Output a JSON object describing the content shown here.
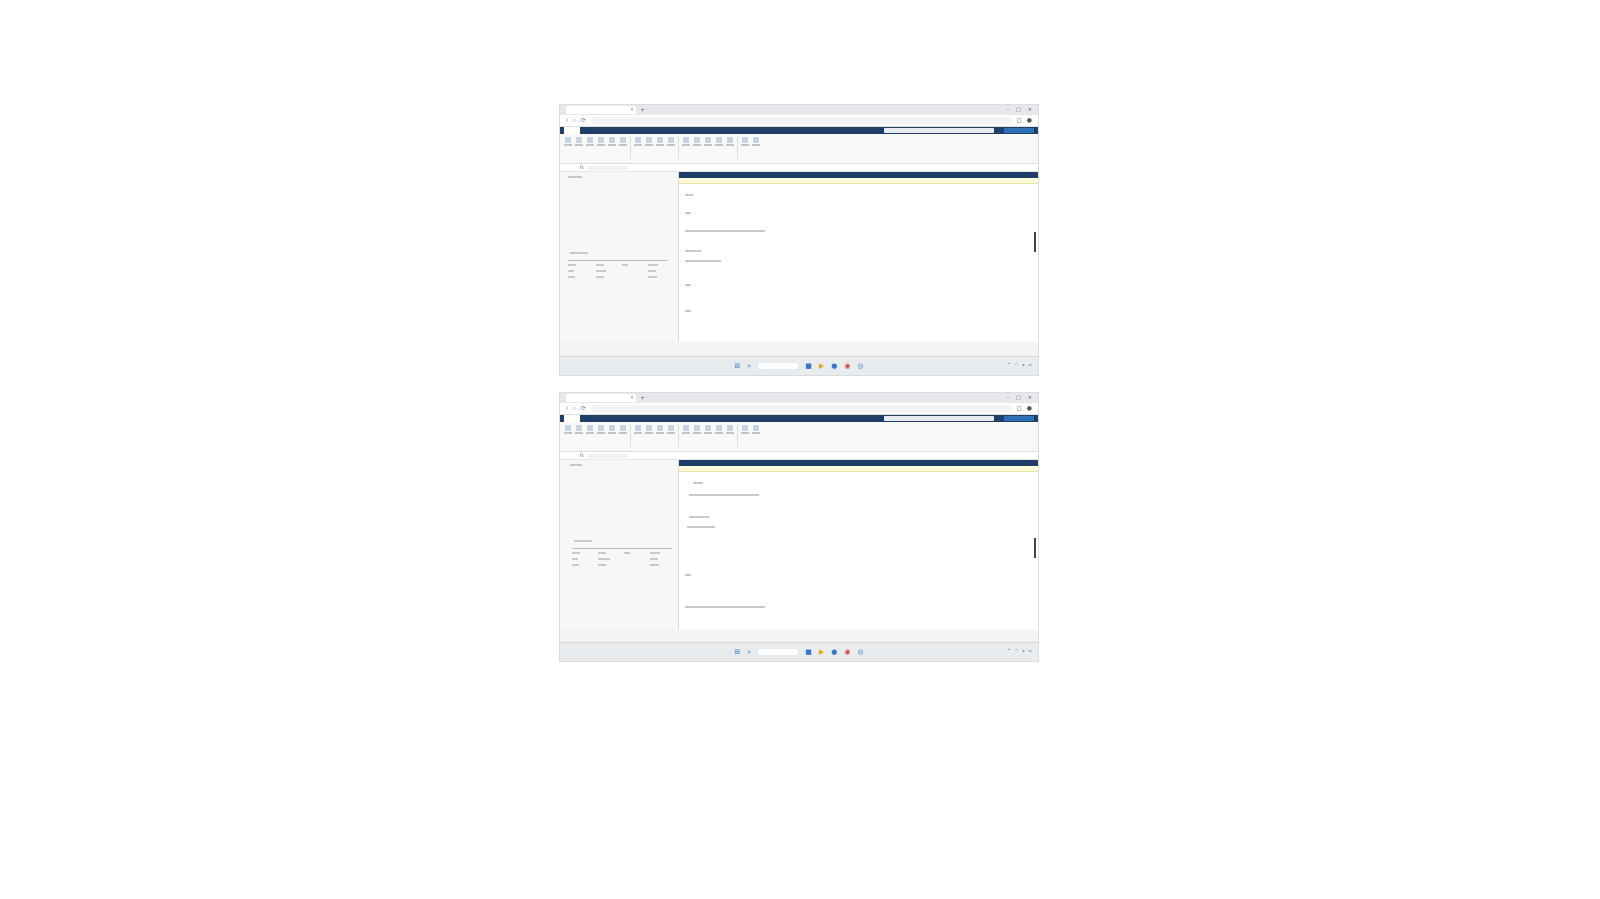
{
  "screenshots": [
    {
      "tab": {
        "title": "",
        "close": "×"
      },
      "new_tab": "+",
      "window_controls": [
        "–",
        "□",
        "×"
      ],
      "address": {
        "url": ""
      },
      "nav_icons": [
        "‹",
        "›",
        "⟳"
      ],
      "app_tabs": [
        "",
        "",
        ""
      ],
      "formula_label": "fx",
      "taskbar_icons": [
        "⊞",
        "⌕",
        "■",
        "▶",
        "●",
        "◉",
        "◎"
      ]
    },
    {
      "tab": {
        "title": "",
        "close": "×"
      },
      "new_tab": "+",
      "window_controls": [
        "–",
        "□",
        "×"
      ],
      "address": {
        "url": ""
      },
      "nav_icons": [
        "‹",
        "›",
        "⟳"
      ],
      "app_tabs": [
        "",
        "",
        ""
      ],
      "formula_label": "fx",
      "taskbar_icons": [
        "⊞",
        "⌕",
        "■",
        "▶",
        "●",
        "◉",
        "◎"
      ]
    }
  ],
  "colors": {
    "app_header": "#1f3f68",
    "banner": "#fdfcd8",
    "taskbar_icon": "#3a78c4"
  }
}
